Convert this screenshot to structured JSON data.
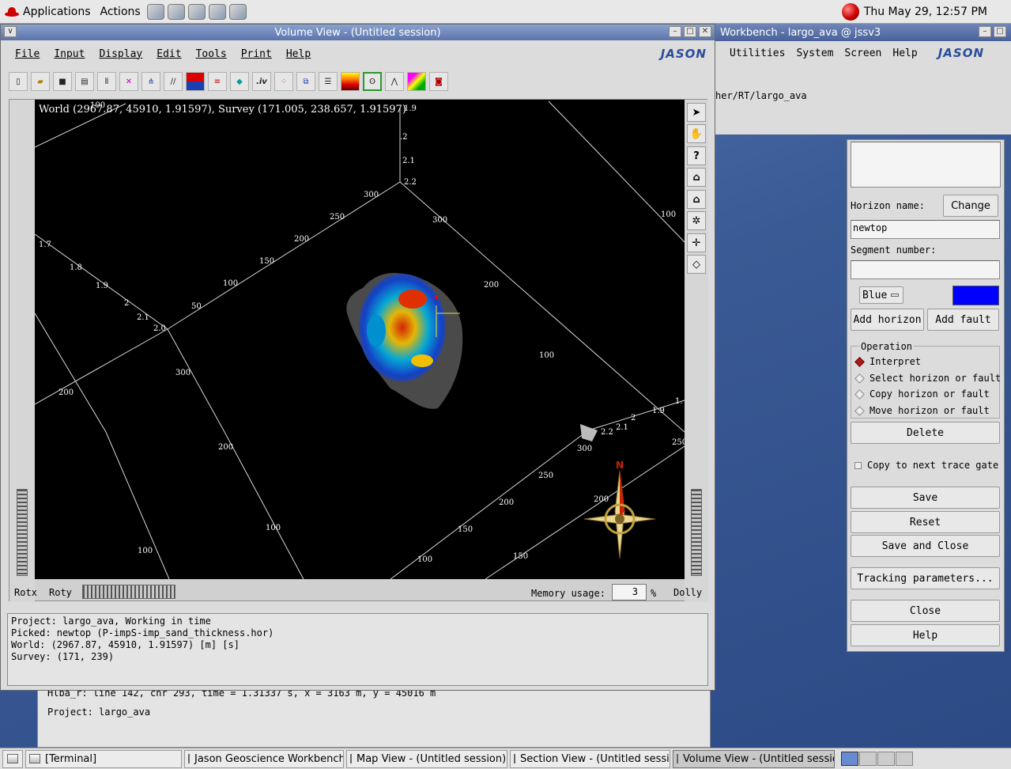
{
  "top_panel": {
    "applications_label": "Applications",
    "actions_label": "Actions",
    "clock": "Thu May 29, 12:57 PM"
  },
  "behind_window": {
    "title": "Workbench - largo_ava @ jssv3",
    "menus": [
      "Utilities",
      "System",
      "Screen",
      "Help"
    ],
    "path_text": "her/RT/largo_ava",
    "logo": "JASON"
  },
  "main_window": {
    "title": "Volume View - (Untitled session)",
    "menus": [
      "File",
      "Input",
      "Display",
      "Edit",
      "Tools",
      "Print",
      "Help"
    ],
    "logo": "JASON",
    "viewer_readout": "World (2967.87, 45910, 1.91597), Survey (171.005, 238.657, 1.91597)",
    "compass_label": "N",
    "controls": {
      "rotx": "Rotx",
      "roty": "Roty",
      "memory_label": "Memory usage:",
      "memory_value": "3",
      "memory_unit": "%",
      "dolly": "Dolly"
    },
    "status_lines": [
      "Project: largo_ava, Working in time",
      "Picked: newtop (P-impS-imp_sand_thickness.hor)",
      "World: (2967.87, 45910, 1.91597) [m] [s]",
      "Survey: (171, 239)"
    ]
  },
  "grid_labels": [
    "100",
    "1.9",
    ".2",
    "2.1",
    "2.2",
    "300",
    "250",
    "200",
    "150",
    "100",
    "50",
    "1.7",
    "1.8",
    "1.9",
    "2",
    "2.1",
    "2.0",
    "300",
    "200",
    "200",
    "100",
    "100",
    "300",
    "200",
    "100",
    "100",
    "2.2",
    "2.1",
    "2",
    "1.9",
    "1.",
    "300",
    "250",
    "200",
    "150",
    "100",
    "200",
    "150",
    "250"
  ],
  "horizon_panel": {
    "horizon_name_label": "Horizon name:",
    "change_button": "Change",
    "horizon_name_value": "newtop",
    "segment_number_label": "Segment number:",
    "segment_number_value": "",
    "color_option": "Blue",
    "color_swatch": "#0000ff",
    "add_horizon_button": "Add horizon",
    "add_fault_button": "Add fault",
    "operation_label": "Operation",
    "operations": [
      "Interpret",
      "Select horizon or fault",
      "Copy horizon or fault",
      "Move horizon or fault"
    ],
    "selected_operation": "Interpret",
    "delete_button": "Delete",
    "copy_checkbox": "Copy to next trace gate",
    "save_button": "Save",
    "reset_button": "Reset",
    "save_close_button": "Save and Close",
    "tracking_button": "Tracking parameters...",
    "close_button": "Close",
    "help_button": "Help"
  },
  "terminal_under": {
    "line1": "Hlba_r: line 142, cnr 293, time = 1.31337 s, x =     3163 m, y =    45016 m",
    "line2": "Project: largo_ava"
  },
  "taskbar": {
    "tasks": [
      "[Terminal]",
      "Jason Geoscience Workbench",
      "Map View - (Untitled session) @",
      "Section View - (Untitled sessio",
      "Volume View - (Untitled session"
    ]
  }
}
